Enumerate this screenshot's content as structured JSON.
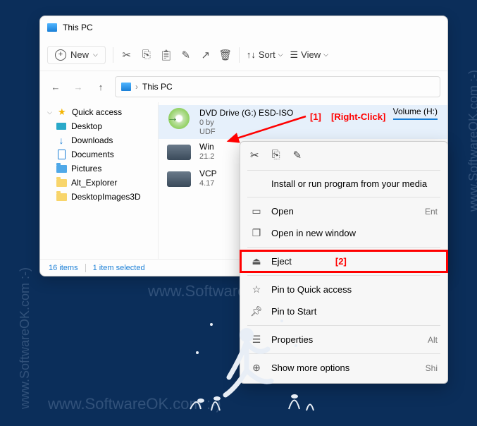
{
  "window": {
    "title": "This PC"
  },
  "toolbar": {
    "new": "New",
    "sort": "Sort",
    "view": "View"
  },
  "address": {
    "path": "This PC"
  },
  "sidebar": {
    "quick": "Quick access",
    "items": [
      {
        "label": "Desktop"
      },
      {
        "label": "Downloads"
      },
      {
        "label": "Documents"
      },
      {
        "label": "Pictures"
      },
      {
        "label": "Alt_Explorer"
      },
      {
        "label": "DesktopImages3D"
      }
    ]
  },
  "drives": [
    {
      "name": "DVD Drive (G:) ESD-ISO",
      "sub1": "0 by",
      "sub2": "UDF"
    },
    {
      "name": "Win",
      "sub1": "21.2"
    },
    {
      "name": "VCP",
      "sub1": "4.17"
    }
  ],
  "volume_tab": "Volume (H:)",
  "status": {
    "items": "16 items",
    "selected": "1 item selected"
  },
  "context_menu": {
    "install": "Install or run program from your media",
    "open": "Open",
    "open_new": "Open in new window",
    "eject": "Eject",
    "pin_quick": "Pin to Quick access",
    "pin_start": "Pin to Start",
    "properties": "Properties",
    "show_more": "Show more options",
    "shortcut_open": "Ent",
    "shortcut_props": "Alt",
    "shortcut_more": "Shi"
  },
  "annotations": {
    "a1": "[1]",
    "a1_text": "[Right-Click]",
    "a2": "[2]"
  },
  "watermark": "www.SoftwareOK.com :-)"
}
